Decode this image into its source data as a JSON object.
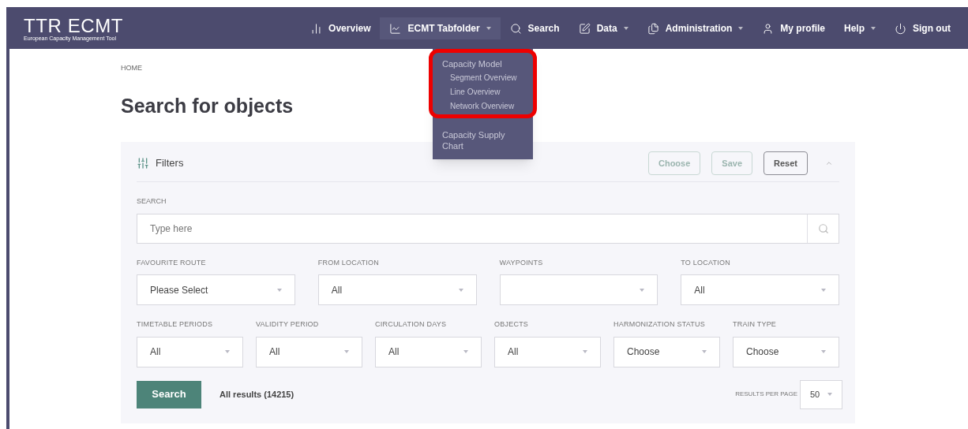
{
  "header": {
    "logo": "TTR ECMT",
    "logo_subtitle": "European Capacity Management Tool",
    "nav": [
      {
        "label": "Overview",
        "dropdown": false,
        "selected": false
      },
      {
        "label": "ECMT Tabfolder",
        "dropdown": true,
        "selected": true
      },
      {
        "label": "Search",
        "dropdown": false,
        "selected": false
      },
      {
        "label": "Data",
        "dropdown": true,
        "selected": false
      },
      {
        "label": "Administration",
        "dropdown": true,
        "selected": false
      },
      {
        "label": "My profile",
        "dropdown": false,
        "selected": false
      },
      {
        "label": "Help",
        "dropdown": true,
        "selected": false
      },
      {
        "label": "Sign out",
        "dropdown": false,
        "selected": false
      }
    ]
  },
  "dropdown_menu": {
    "groups": [
      {
        "label": "Capacity Model",
        "highlighted": true,
        "children": [
          {
            "label": "Segment Overview"
          },
          {
            "label": "Line Overview"
          },
          {
            "label": "Network Overview"
          }
        ]
      },
      {
        "label": "Capacity Supply Chart",
        "highlighted": false
      }
    ]
  },
  "breadcrumb": "HOME",
  "title": "Search for objects",
  "filters": {
    "title": "Filters",
    "buttons": [
      {
        "label": "Choose",
        "disabled": true
      },
      {
        "label": "Save",
        "disabled": true
      },
      {
        "label": "Reset",
        "disabled": false
      }
    ],
    "expanded": true,
    "search": {
      "label": "SEARCH",
      "placeholder": "Type here"
    },
    "route_fields": [
      {
        "label": "FAVOURITE ROUTE",
        "value": "Please Select"
      },
      {
        "label": "FROM LOCATION",
        "value": "All"
      },
      {
        "label": "WAYPOINTS"
      },
      {
        "label": "TO LOCATION",
        "value": "All"
      }
    ],
    "detail_fields": [
      {
        "label": "TIMETABLE PERIODS",
        "value": "All"
      },
      {
        "label": "VALIDITY PERIOD",
        "value": "All"
      },
      {
        "label": "CIRCULATION DAYS",
        "value": "All"
      },
      {
        "label": "OBJECTS",
        "value": "All"
      },
      {
        "label": "HARMONIZATION STATUS",
        "value": "Choose"
      },
      {
        "label": "TRAIN TYPE",
        "value": "Choose"
      }
    ],
    "search_button": "Search",
    "results": "All results (14215)",
    "per_page_label": "RESULTS PER PAGE",
    "per_page": "50"
  }
}
